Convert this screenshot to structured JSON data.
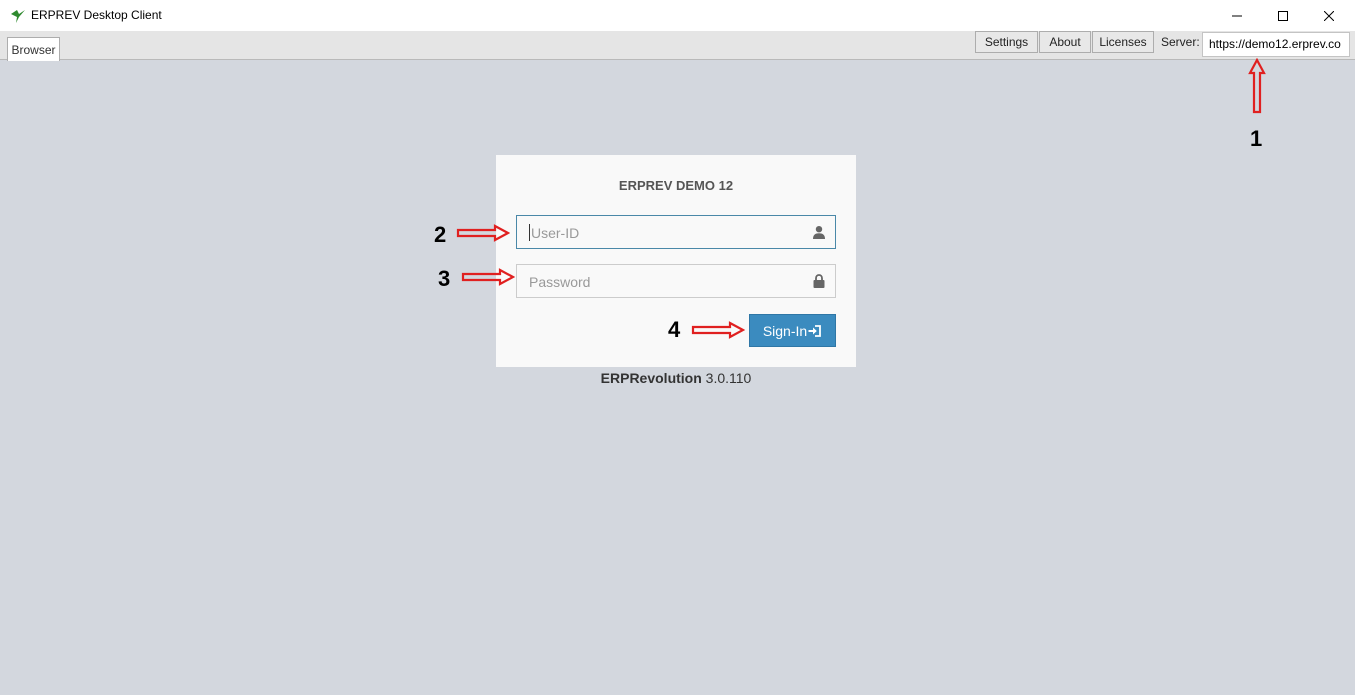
{
  "window": {
    "title": "ERPREV Desktop Client",
    "icon": "erprev-bird-icon",
    "controls": [
      "minimize-icon",
      "maximize-icon",
      "close-icon"
    ]
  },
  "tabs": [
    {
      "label": "Browser",
      "active": true
    }
  ],
  "toolbar": {
    "settings_label": "Settings",
    "about_label": "About",
    "licenses_label": "Licenses",
    "server_label": "Server:",
    "server_value": "https://demo12.erprev.co"
  },
  "login": {
    "title": "ERPREV DEMO 12",
    "user_placeholder": "User-ID",
    "password_placeholder": "Password",
    "signin_label": "Sign-In"
  },
  "footer": {
    "product": "ERPRevolution",
    "version": "3.0.110"
  },
  "annotations": [
    "1",
    "2",
    "3",
    "4"
  ],
  "colors": {
    "background": "#d3d7de",
    "signin": "#3b8bbf",
    "annotation_arrow": "#e02020"
  }
}
